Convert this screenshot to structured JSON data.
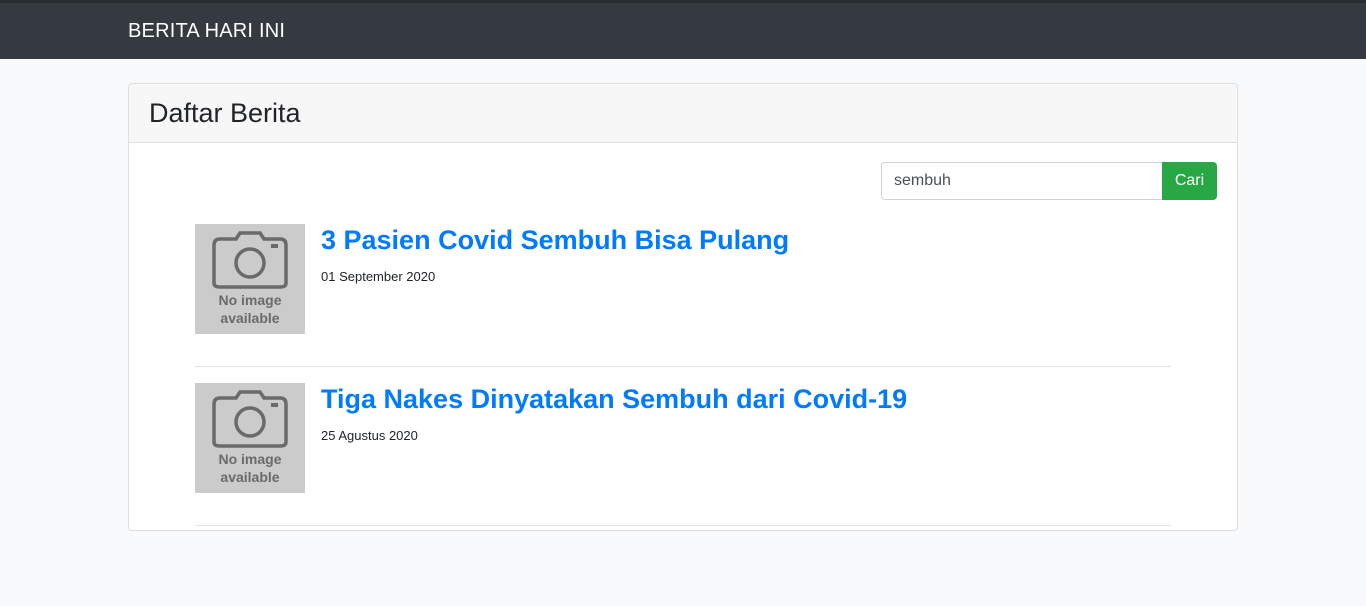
{
  "navbar": {
    "brand": "BERITA HARI INI"
  },
  "card": {
    "title": "Daftar Berita"
  },
  "search": {
    "value": "sembuh",
    "button_label": "Cari"
  },
  "placeholder_image": {
    "line1": "No image",
    "line2": "available",
    "icon": "camera-icon"
  },
  "news": [
    {
      "title": "3 Pasien Covid Sembuh Bisa Pulang",
      "date": "01 September 2020"
    },
    {
      "title": "Tiga Nakes Dinyatakan Sembuh dari Covid-19",
      "date": "25 Agustus 2020"
    }
  ],
  "colors": {
    "navbar": "#343a40",
    "link": "#007bff",
    "button": "#28a745"
  }
}
